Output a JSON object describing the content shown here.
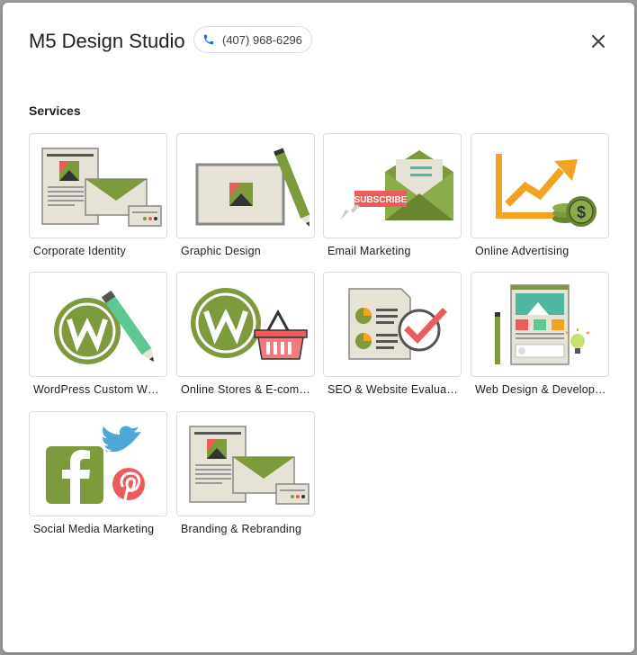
{
  "header": {
    "title": "M5 Design Studio",
    "phone": "(407) 968-6296"
  },
  "services": {
    "heading": "Services",
    "items": [
      {
        "label": "Corporate Identity",
        "icon": "stationery-icon"
      },
      {
        "label": "Graphic Design",
        "icon": "canvas-pencil-icon"
      },
      {
        "label": "Email Marketing",
        "icon": "envelope-subscribe-icon",
        "icon_text": "SUBSCRIBE"
      },
      {
        "label": "Online Advertising",
        "icon": "growth-chart-icon",
        "icon_text": "$"
      },
      {
        "label": "WordPress Custom W…",
        "icon": "wordpress-pencil-icon"
      },
      {
        "label": "Online Stores & E-com…",
        "icon": "wordpress-basket-icon"
      },
      {
        "label": "SEO & Website Evaluat…",
        "icon": "checklist-icon"
      },
      {
        "label": "Web Design & Develop…",
        "icon": "webpage-icon"
      },
      {
        "label": "Social Media Marketing",
        "icon": "social-media-icon"
      },
      {
        "label": "Branding & Rebranding",
        "icon": "stationery-icon"
      }
    ]
  },
  "colors": {
    "green": "#7d9a3c",
    "red": "#ee5b5b",
    "orange": "#f2a322",
    "cream": "#e6e3d6"
  }
}
